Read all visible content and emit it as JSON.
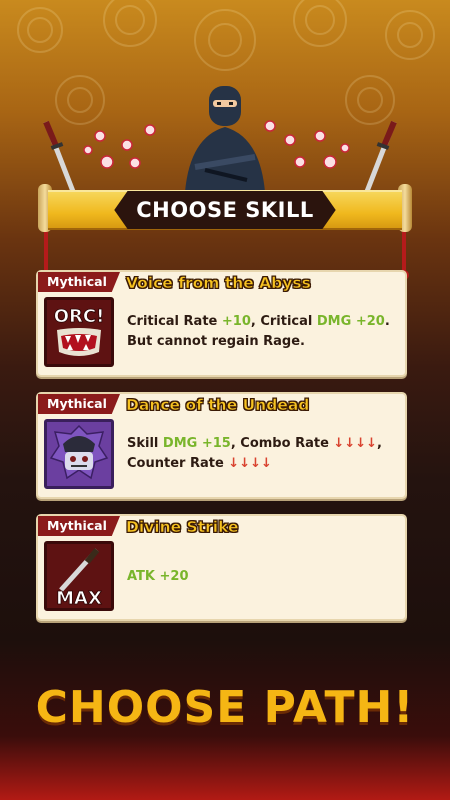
{
  "header": {
    "banner_title": "CHOOSE SKILL"
  },
  "skills": [
    {
      "rarity": "Mythical",
      "name": "Voice from the Abyss",
      "icon": "orc-mask-icon",
      "icon_text": "ORC!",
      "desc_parts": [
        "Critical Rate ",
        "+10",
        ", Critical ",
        "DMG +20",
        ".",
        "But cannot regain Rage."
      ]
    },
    {
      "rarity": "Mythical",
      "name": "Dance of the Undead",
      "icon": "undead-samurai-icon",
      "desc_parts": [
        "Skill ",
        "DMG +15",
        ", Combo Rate ",
        "↓↓↓↓",
        ",",
        "Counter Rate ",
        "↓↓↓↓"
      ]
    },
    {
      "rarity": "Mythical",
      "name": "Divine Strike",
      "icon": "katana-max-icon",
      "icon_text": "MAX",
      "desc_parts": [
        "ATK +20"
      ]
    }
  ],
  "footer": {
    "cta": "CHOOSE PATH!"
  },
  "colors": {
    "gold": "#f5b614",
    "mythical_tag": "#8b1b1b",
    "buff_green": "#79b52b",
    "debuff_red": "#d9432f"
  }
}
